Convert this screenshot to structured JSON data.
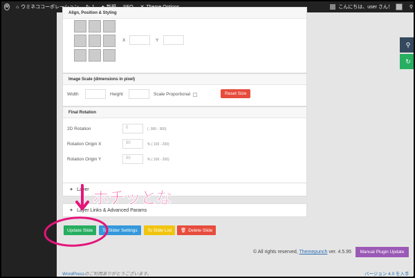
{
  "adminbar": {
    "site_name": "ウミネココーポレーション",
    "updates_count": "1",
    "new_label": "新規",
    "seo_label": "SEO",
    "theme_options_label": "Theme Options",
    "greeting": "こんにちは、user さん！",
    "icons": [
      "wordpress-logo",
      "home-icon",
      "refresh-icon",
      "plus-icon",
      "tools-icon",
      "avatar"
    ]
  },
  "panels": {
    "align": {
      "title": "Align, Position & Styling",
      "x_label": "X",
      "y_label": "Y",
      "x_value": "",
      "y_value": ""
    },
    "image_scale": {
      "title": "Image Scale (dimensions in pixel)",
      "width_label": "Width",
      "height_label": "Height",
      "scale_proportional_label": "Scale Proportional",
      "reset_label": "Reset Size"
    },
    "final_rotation": {
      "title": "Final Rotation",
      "rotation_label": "2D Rotation",
      "rotation_value": "0",
      "rotation_hint": "( -360 - 360)",
      "origin_x_label": "Rotation Origin X",
      "origin_x_value": "50",
      "origin_x_hint": "% ( 100 - 200)",
      "origin_y_label": "Rotation Origin Y",
      "origin_y_value": "50",
      "origin_y_hint": "% ( 100 - 200)"
    }
  },
  "collapsibles": {
    "layer_visible": "Layer",
    "layer_links": "Layer Links & Advanced Params"
  },
  "actions": {
    "update": "Update Slide",
    "slider_settings": "To Slider Settings",
    "slide_list": "To Slide List",
    "delete": "Delete Slide"
  },
  "footer": {
    "rights": "© All rights reserved,",
    "company": "Themepunch",
    "version": "ver. 4.5.95",
    "manual_update": "Manual Plugin Update",
    "wp_link": "WordPress",
    "wp_thanks": "のご利用ありがとうございます。",
    "wp_version": "バージョン 4.0 を入手"
  },
  "annotation": {
    "text": "ポチッとな"
  },
  "colors": {
    "adminbar_bg": "#222222",
    "update_green": "#27ae60",
    "settings_blue": "#3498db",
    "list_yellow": "#f1c40f",
    "delete_red": "#e74c3c",
    "manual_purple": "#9b59b6",
    "annotation_pink": "#e5157a"
  }
}
